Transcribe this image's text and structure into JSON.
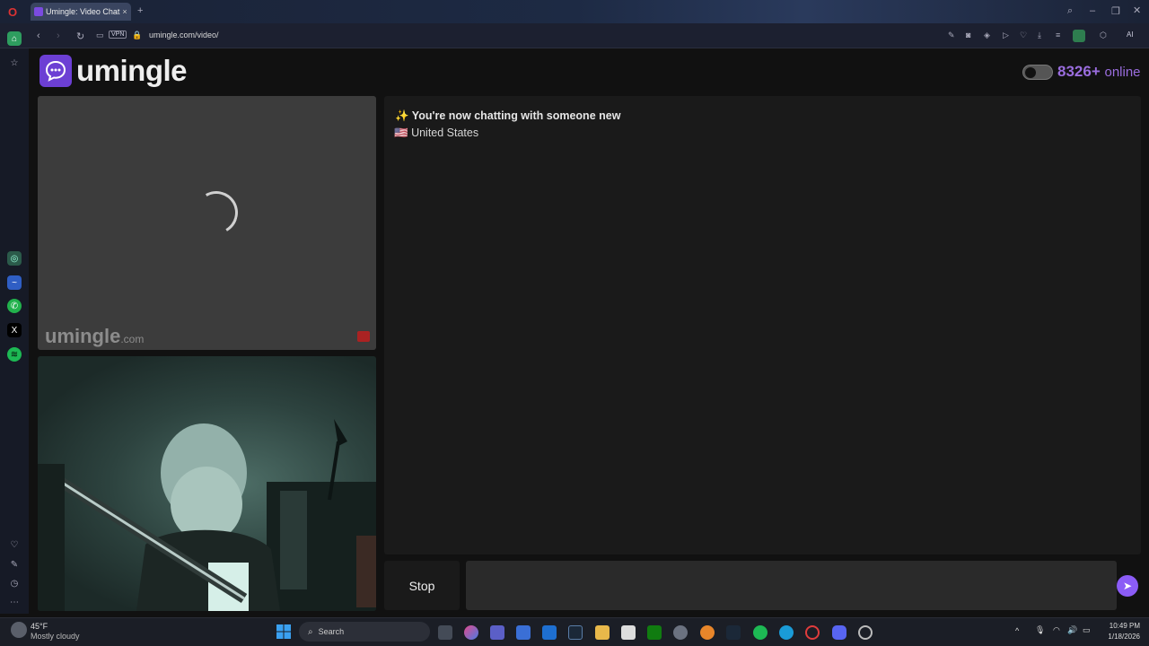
{
  "browser": {
    "tab_title": "Umingle: Video Chat",
    "url": "umingle.com/video/",
    "vpn_label": "VPN",
    "ai_label": "AI"
  },
  "site": {
    "logo_text": "umingle",
    "online_count": "8326+",
    "online_label": "online",
    "watermark_main": "umingle",
    "watermark_suffix": ".com"
  },
  "chat": {
    "status_message": "✨ You're now chatting with someone new",
    "country_flag": "🇺🇸",
    "country": "United States"
  },
  "controls": {
    "stop_label": "Stop",
    "message_placeholder": ""
  },
  "taskbar": {
    "weather_temp": "45°F",
    "weather_desc": "Mostly cloudy",
    "search_label": "Search",
    "time": "10:49 PM",
    "date": "1/18/2026"
  },
  "colors": {
    "accent": "#8b5cf6",
    "logo_bg": "#6c3fd4",
    "online_text": "#9a6dde"
  }
}
